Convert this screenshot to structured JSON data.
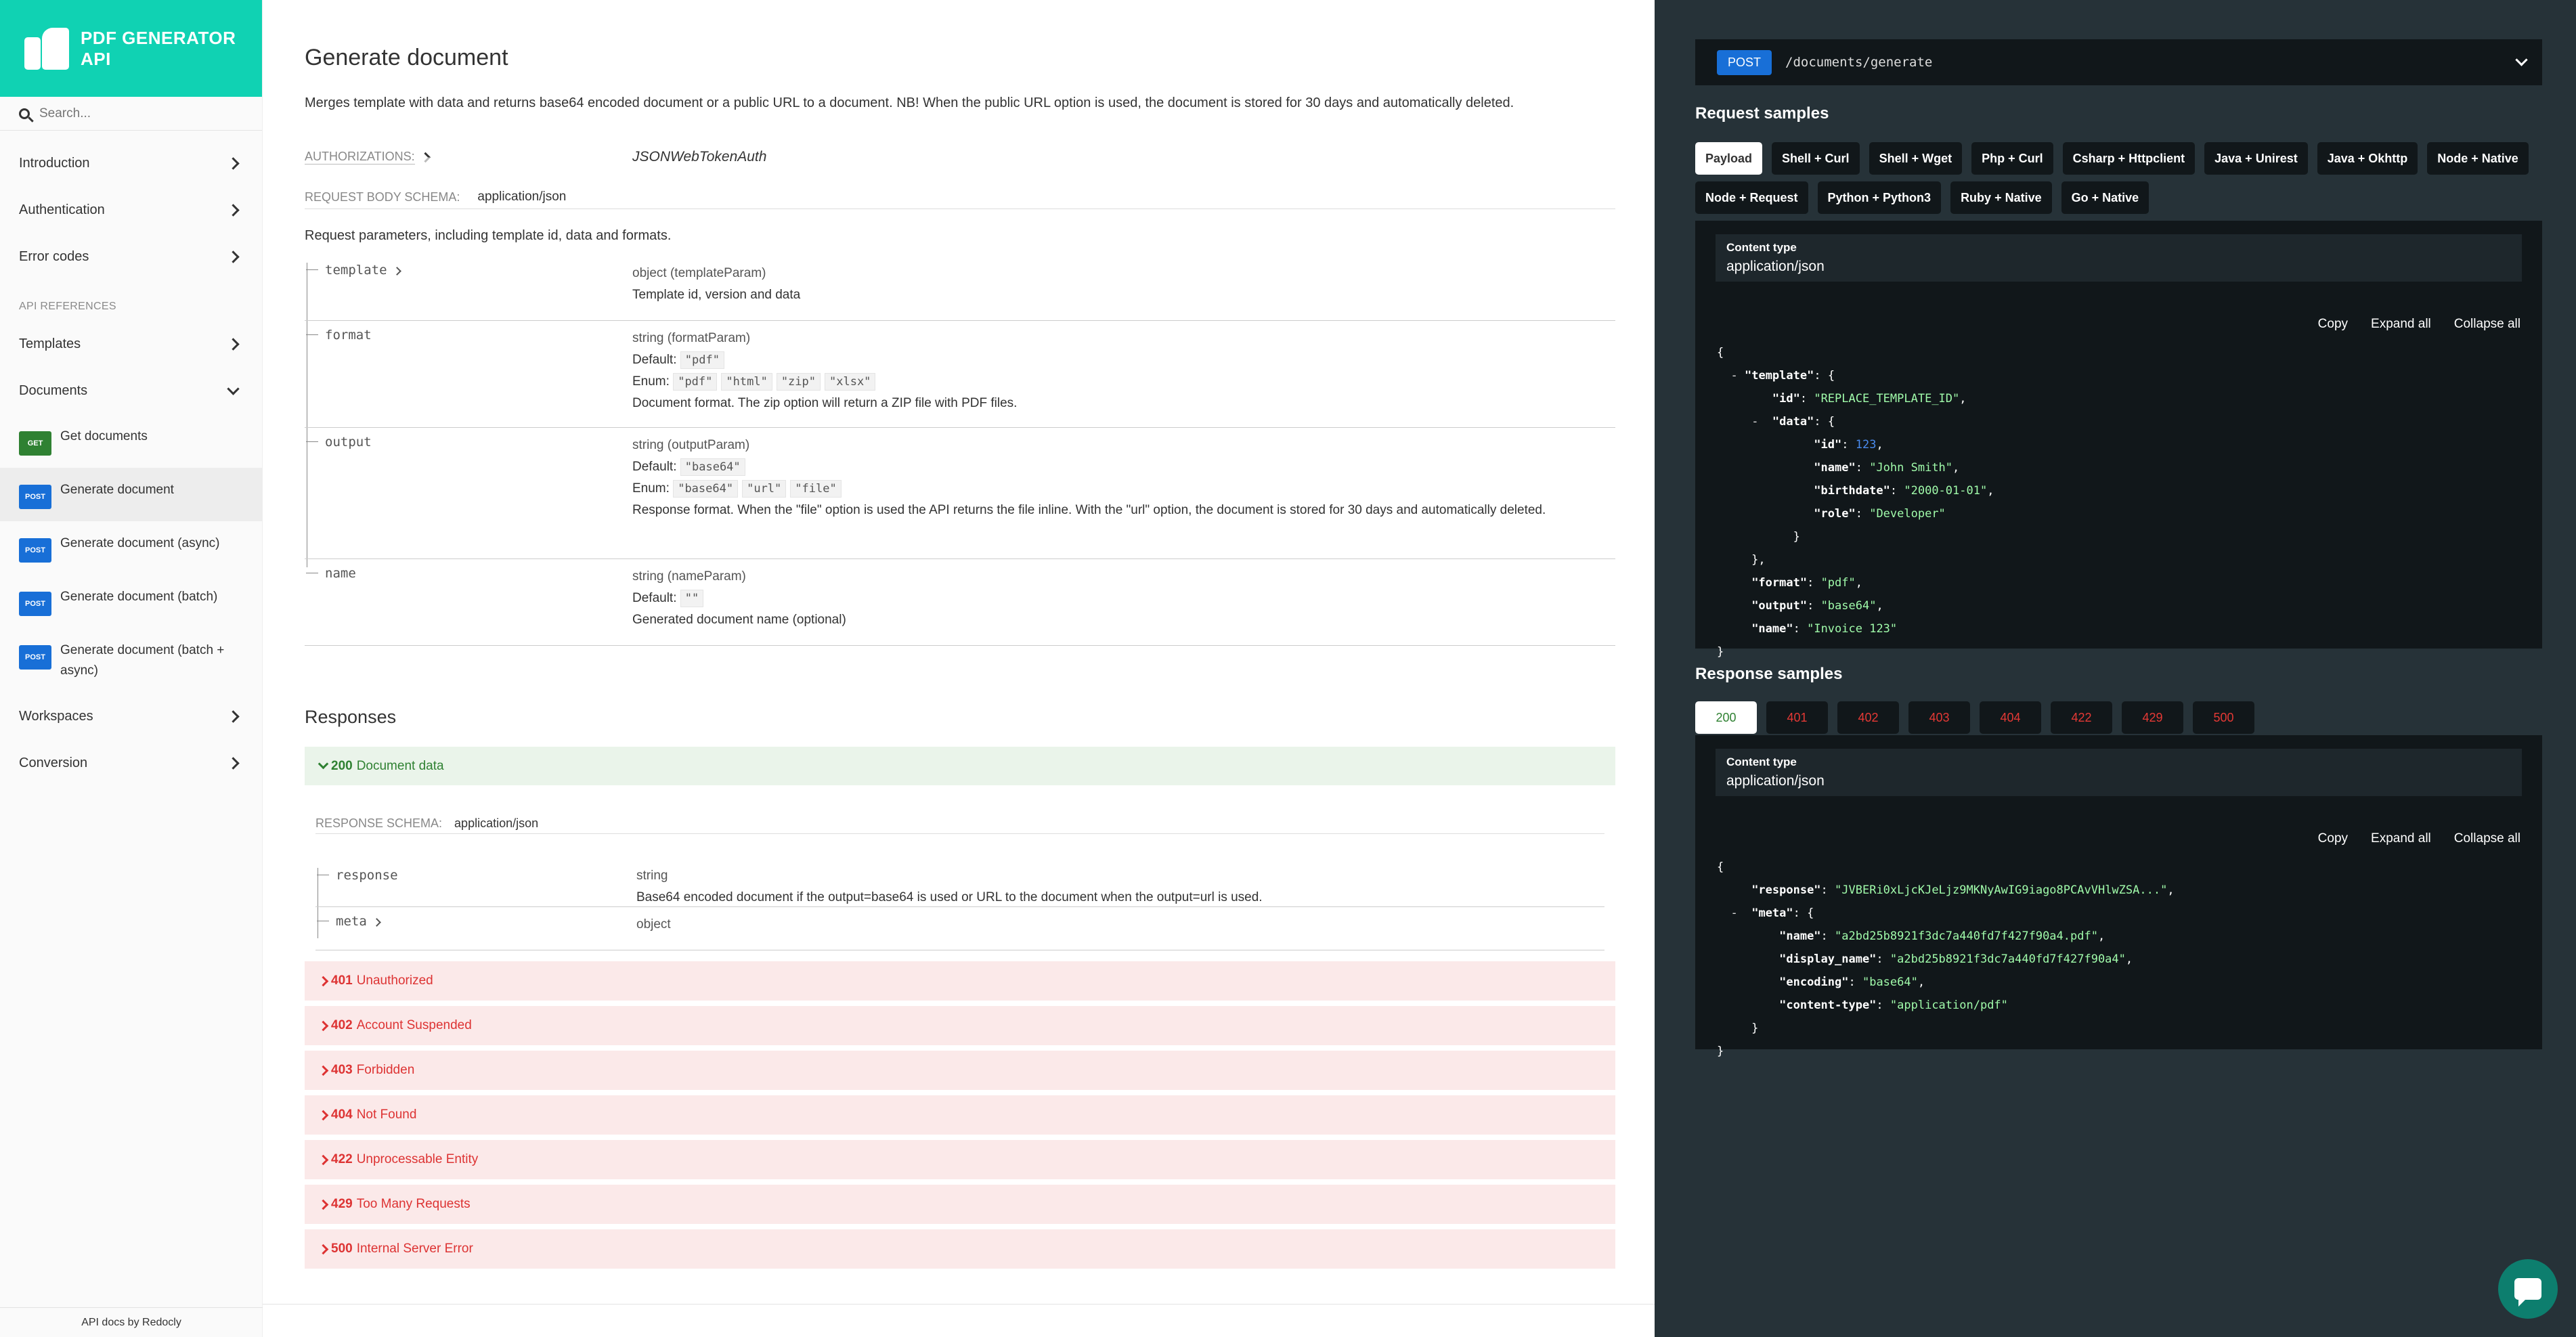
{
  "sidebar": {
    "logo_text": "PDF GENERATOR API",
    "search_placeholder": "Search...",
    "top_items": [
      "Introduction",
      "Authentication",
      "Error codes"
    ],
    "section_label": "API REFERENCES",
    "templates_label": "Templates",
    "documents_label": "Documents",
    "doc_ops": [
      {
        "method": "GET",
        "label": "Get documents"
      },
      {
        "method": "POST",
        "label": "Generate document"
      },
      {
        "method": "POST",
        "label": "Generate document (async)"
      },
      {
        "method": "POST",
        "label": "Generate document (batch)"
      },
      {
        "method": "POST",
        "label": "Generate document (batch + async)"
      }
    ],
    "bottom_items": [
      "Workspaces",
      "Conversion"
    ],
    "footer": "API docs by Redocly"
  },
  "main": {
    "title": "Generate document",
    "description": "Merges template with data and returns base64 encoded document or a public URL to a document. NB! When the public URL option is used, the document is stored for 30 days and automatically deleted.",
    "auth_label": "AUTHORIZATIONS:",
    "auth_value": "JSONWebTokenAuth",
    "schema_label": "REQUEST BODY SCHEMA:",
    "schema_value": "application/json",
    "request_desc": "Request parameters, including template id, data and formats.",
    "params": {
      "template": {
        "name": "template",
        "type": "object (templateParam)",
        "desc": "Template id, version and data"
      },
      "format": {
        "name": "format",
        "type": "string (formatParam)",
        "default_label": "Default:",
        "default": "\"pdf\"",
        "enum_label": "Enum:",
        "enum": [
          "\"pdf\"",
          "\"html\"",
          "\"zip\"",
          "\"xlsx\""
        ],
        "desc": "Document format. The zip option will return a ZIP file with PDF files."
      },
      "output": {
        "name": "output",
        "type": "string (outputParam)",
        "default_label": "Default:",
        "default": "\"base64\"",
        "enum_label": "Enum:",
        "enum": [
          "\"base64\"",
          "\"url\"",
          "\"file\""
        ],
        "desc": "Response format. When the \"file\" option is used the API returns the file inline. With the \"url\" option, the document is stored for 30 days and automatically deleted."
      },
      "name": {
        "name": "name",
        "type": "string (nameParam)",
        "default_label": "Default:",
        "default": "\"\"",
        "desc": "Generated document name (optional)"
      }
    },
    "responses_title": "Responses",
    "ok_response": {
      "code": "200",
      "label": "Document data"
    },
    "resp_schema_label": "RESPONSE SCHEMA:",
    "resp_schema_value": "application/json",
    "resp_params": {
      "response": {
        "name": "response",
        "type": "string",
        "desc": "Base64 encoded document if the output=base64 is used or URL to the document when the output=url is used."
      },
      "meta": {
        "name": "meta",
        "type": "object"
      }
    },
    "error_responses": [
      {
        "code": "401",
        "label": "Unauthorized"
      },
      {
        "code": "402",
        "label": "Account Suspended"
      },
      {
        "code": "403",
        "label": "Forbidden"
      },
      {
        "code": "404",
        "label": "Not Found"
      },
      {
        "code": "422",
        "label": "Unprocessable Entity"
      },
      {
        "code": "429",
        "label": "Too Many Requests"
      },
      {
        "code": "500",
        "label": "Internal Server Error"
      }
    ]
  },
  "right": {
    "method": "POST",
    "path": "/documents/generate",
    "request_title": "Request samples",
    "request_tabs": [
      "Payload",
      "Shell + Curl",
      "Shell + Wget",
      "Php + Curl",
      "Csharp + Httpclient",
      "Java + Unirest",
      "Java + Okhttp",
      "Node + Native",
      "Node + Request",
      "Python + Python3",
      "Ruby + Native",
      "Go + Native"
    ],
    "content_type_label": "Content type",
    "content_type_value": "application/json",
    "copy": "Copy",
    "expand_all": "Expand all",
    "collapse_all": "Collapse all",
    "request_json": {
      "template_key": "\"template\"",
      "id_key": "\"id\"",
      "id_val": "\"REPLACE_TEMPLATE_ID\"",
      "data_key": "\"data\"",
      "data_id_key": "\"id\"",
      "data_id_val": "123",
      "name_key": "\"name\"",
      "name_val": "\"John Smith\"",
      "birthdate_key": "\"birthdate\"",
      "birthdate_val": "\"2000-01-01\"",
      "role_key": "\"role\"",
      "role_val": "\"Developer\"",
      "format_key": "\"format\"",
      "format_val": "\"pdf\"",
      "output_key": "\"output\"",
      "output_val": "\"base64\"",
      "docname_key": "\"name\"",
      "docname_val": "\"Invoice 123\""
    },
    "response_title": "Response samples",
    "response_tabs": [
      "200",
      "401",
      "402",
      "403",
      "404",
      "422",
      "429",
      "500"
    ],
    "response_json": {
      "response_key": "\"response\"",
      "response_val": "\"JVBERi0xLjcKJeLjz9MKNyAwIG9iago8PCAvVHlwZSA...\"",
      "meta_key": "\"meta\"",
      "name_key": "\"name\"",
      "name_val": "\"a2bd25b8921f3dc7a440fd7f427f90a4.pdf\"",
      "display_key": "\"display_name\"",
      "display_val": "\"a2bd25b8921f3dc7a440fd7f427f90a4\"",
      "encoding_key": "\"encoding\"",
      "encoding_val": "\"base64\"",
      "ctype_key": "\"content-type\"",
      "ctype_val": "\"application/pdf\""
    }
  }
}
